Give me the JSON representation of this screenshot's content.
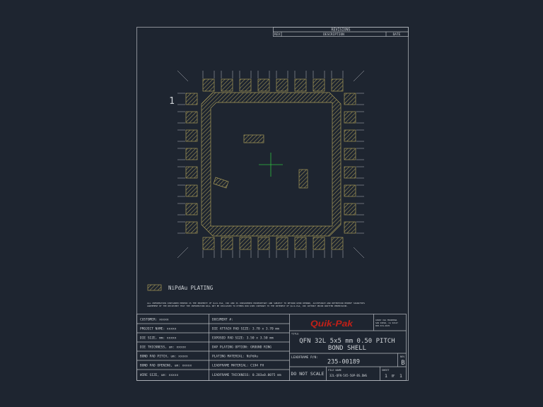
{
  "revisions": {
    "title": "REVISIONS",
    "col_rev": "REV",
    "col_desc": "DESCRIPTION",
    "col_date": "DATE"
  },
  "pin_one_marker": "1",
  "legend": {
    "label": "NiPdAu PLATING"
  },
  "disclaimer": [
    "ALL INFORMATION CONTAINED HEREIN IS THE PROPERTY OF Quik-Pak, INC AND IS CONSIDERED PROPRIETARY AND SUBJECT TO RETURN UPON DEMAND, ACCEPTANCE AND RETENTION HEREOF SIGNIFIES",
    "AGREEMENT BY THE RECIPIENT THAT THE INFORMATION WILL NOT BE DISCLOSED TO OTHERS NOR USED CONTRARY TO THE INTEREST OF Quik-Pak, INC WITHOUT PRIOR WRITTEN PERMISSION."
  ],
  "specs": {
    "customer": "CUSTOMER:  xxxxx",
    "project_name": "PROJECT NAME: xxxxx",
    "die_size": "DIE SIZE, mm: xxxxx",
    "die_thickness": "DIE THICKNESS, um: xxxxx",
    "bond_pad_pitch": "BOND PAD PITCH, um: xxxxx",
    "bond_pad_opening": "BOND PAD OPENING, um:  xxxxx",
    "wire_size": "WIRE SIZE, um:  xxxxx",
    "document": "DOCUMENT #:",
    "die_attach_pad_size": "DIE ATTACH PAD SIZE:  3.70 x 3.70 mm",
    "exposed_pad_size": "EXPOSED PAD SIZE:  3.50 x 3.50 mm",
    "dap_plating_option": "DAP PLATING OPTION:  GROUND RING",
    "plating_material": "PLATING MATERIAL:  NiPdAu",
    "leadframe_material": "LEADFRAME MATERIAL:  C194 FH",
    "leadframe_thickness": "LEADFRAME THICKNESS: 0.203±0.0075 mm"
  },
  "company": {
    "logo_text": "Quik-Pak",
    "address": [
      "10987 VIA FRONTERA",
      "SAN DIEGO, CA 92127",
      "858-674-4676"
    ]
  },
  "title_block": {
    "title_label": "TITLE",
    "title_line1": "QFN 32L 5x5 mm 0.50 PITCH",
    "title_line2": "BOND SHELL",
    "leadframe_pn_label": "LEADFRAME P/N:",
    "leadframe_pn": "235-00189",
    "rev_label": "REV",
    "rev": "B",
    "do_not_scale": "DO NOT SCALE",
    "file_name_label": "FILE NAME",
    "file_name": "32L-QFN-5X5-50P-BS.DWG",
    "sheet_label": "SHEET",
    "sheet": "1",
    "sheet_of": "OF",
    "sheet_total": "1"
  },
  "colors": {
    "background": "#1e2530",
    "hatch": "#a89a58",
    "lines": "#b8bcc2",
    "crosshair": "#2fbf3f",
    "logo": "#c02018"
  }
}
